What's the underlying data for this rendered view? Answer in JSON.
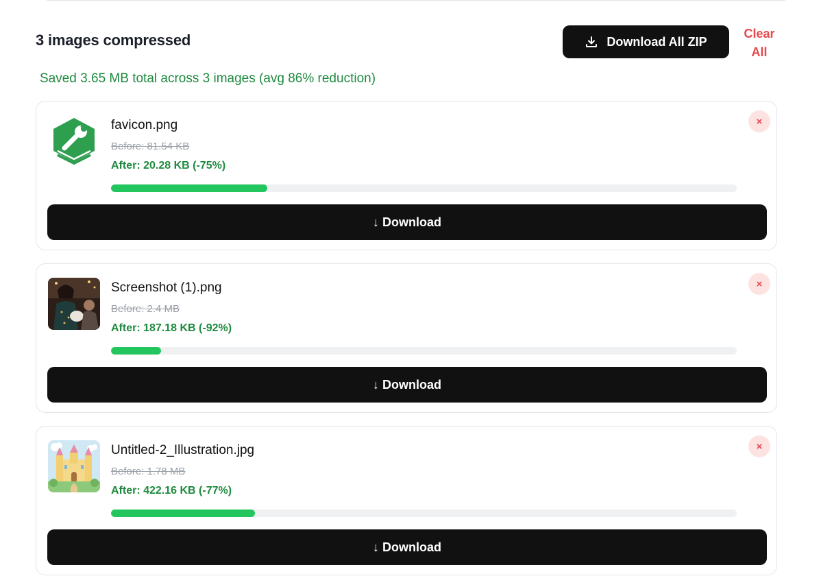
{
  "header": {
    "title": "3 images compressed",
    "download_all_label": "Download All ZIP",
    "download_all_icon": "download-icon",
    "clear_all_label": "Clear All"
  },
  "summary": "Saved 3.65 MB total across 3 images (avg 86% reduction)",
  "colors": {
    "accent_green": "#22c55e",
    "saved_text": "#1e8a3e",
    "danger": "#e5484d",
    "button_dark": "#111111"
  },
  "files": [
    {
      "name": "favicon.png",
      "thumbnail": "green-wrench-logo",
      "before": "Before: 81.54 KB",
      "after": "After: 20.28 KB (-75%)",
      "progress": 0.25,
      "remove_label": "×",
      "download_label": "↓ Download"
    },
    {
      "name": "Screenshot (1).png",
      "thumbnail": "photo-person-crowd",
      "before": "Before: 2.4 MB",
      "after": "After: 187.18 KB (-92%)",
      "progress": 0.08,
      "remove_label": "×",
      "download_label": "↓ Download"
    },
    {
      "name": "Untitled-2_Illustration.jpg",
      "thumbnail": "castle-illustration",
      "before": "Before: 1.78 MB",
      "after": "After: 422.16 KB (-77%)",
      "progress": 0.23,
      "remove_label": "×",
      "download_label": "↓ Download"
    }
  ]
}
